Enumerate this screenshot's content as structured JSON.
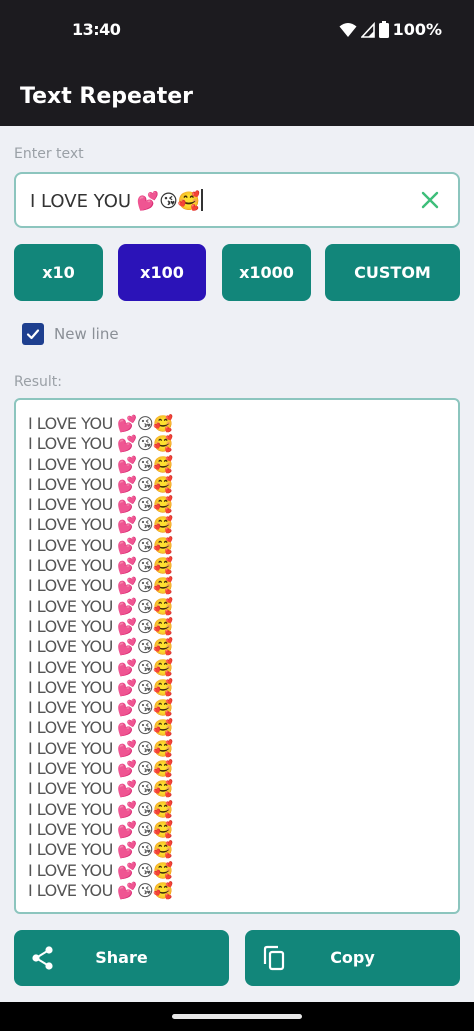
{
  "status_bar": {
    "time": "13:40",
    "battery": "100%"
  },
  "app_bar": {
    "title": "Text Repeater"
  },
  "input": {
    "label": "Enter text",
    "value": "I LOVE YOU 💕😘🥰"
  },
  "repeat_buttons": [
    {
      "label": "x10",
      "active": false
    },
    {
      "label": "x100",
      "active": true
    },
    {
      "label": "x1000",
      "active": false
    },
    {
      "label": "CUSTOM",
      "active": false
    }
  ],
  "new_line": {
    "label": "New line",
    "checked": true
  },
  "result": {
    "label": "Result:",
    "lines": [
      "I LOVE YOU 💕😘🥰",
      "I LOVE YOU 💕😘🥰",
      "I LOVE YOU 💕😘🥰",
      "I LOVE YOU 💕😘🥰",
      "I LOVE YOU 💕😘🥰",
      "I LOVE YOU 💕😘🥰",
      "I LOVE YOU 💕😘🥰",
      "I LOVE YOU 💕😘🥰",
      "I LOVE YOU 💕😘🥰",
      "I LOVE YOU 💕😘🥰",
      "I LOVE YOU 💕😘🥰",
      "I LOVE YOU 💕😘🥰",
      "I LOVE YOU 💕😘🥰",
      "I LOVE YOU 💕😘🥰",
      "I LOVE YOU 💕😘🥰",
      "I LOVE YOU 💕😘🥰",
      "I LOVE YOU 💕😘🥰",
      "I LOVE YOU 💕😘🥰",
      "I LOVE YOU 💕😘🥰",
      "I LOVE YOU 💕😘🥰",
      "I LOVE YOU 💕😘🥰",
      "I LOVE YOU 💕😘🥰",
      "I LOVE YOU 💕😘🥰",
      "I LOVE YOU 💕😘🥰"
    ]
  },
  "actions": {
    "share_label": "Share",
    "copy_label": "Copy"
  },
  "icons": {
    "clear": "close-icon",
    "share": "share-icon",
    "copy": "copy-icon",
    "wifi": "wifi-icon",
    "signal": "signal-icon",
    "battery": "battery-icon",
    "check": "check-icon"
  },
  "colors": {
    "app_bar": "#1C1B1F",
    "accent": "#12867A",
    "active_button": "#2B13B8",
    "background": "#EEF0F5",
    "input_border": "#8CC5BE",
    "clear_icon": "#3DBE7A",
    "checkbox": "#1E3F8F"
  }
}
